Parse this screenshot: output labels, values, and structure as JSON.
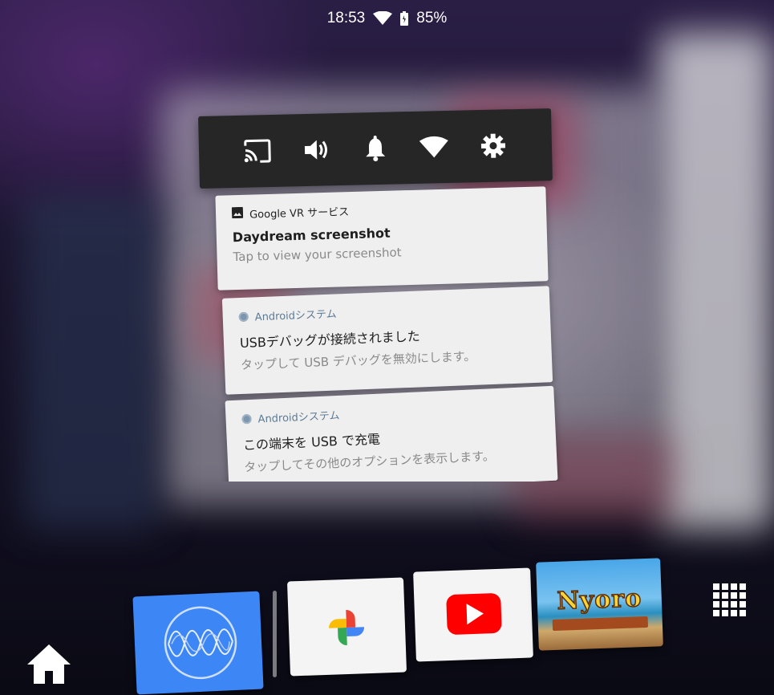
{
  "status_bar": {
    "time": "18:53",
    "battery": "85%",
    "wifi_icon": "wifi-icon",
    "battery_icon": "battery-icon"
  },
  "quick_settings": {
    "icons": [
      "cast-icon",
      "volume-icon",
      "bell-icon",
      "wifi-icon",
      "gear-icon"
    ]
  },
  "notifications": [
    {
      "app": "Google VR サービス",
      "icon": "image-icon",
      "title": "Daydream screenshot",
      "text": "Tap to view your screenshot"
    },
    {
      "app": "Androidシステム",
      "icon": "android-system-icon",
      "title": "USBデバッグが接続されました",
      "text": "タップして USB デバッグを無効にします。"
    },
    {
      "app": "Androidシステム",
      "icon": "android-system-icon",
      "title": "この端末を USB で充電",
      "text": "タップしてその他のオプションを表示します。"
    }
  ],
  "launcher": {
    "apps": [
      "waves-app",
      "google-photos",
      "youtube",
      "nyoro-game"
    ],
    "game_title": "Nyoro",
    "colors": {
      "waves": "#3d86f5",
      "youtube_red": "#ff0000"
    }
  }
}
